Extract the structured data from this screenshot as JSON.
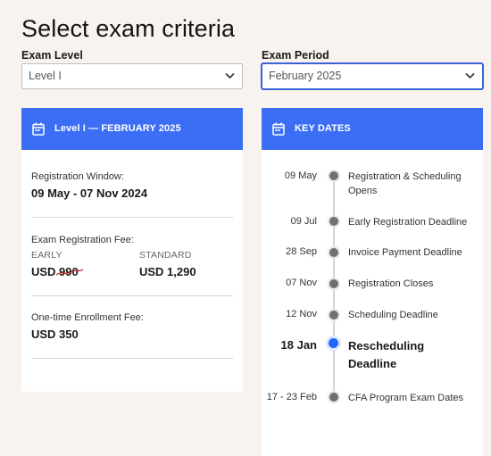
{
  "page": {
    "title": "Select exam criteria"
  },
  "filters": {
    "level_label": "Exam Level",
    "level_value": "Level I",
    "period_label": "Exam Period",
    "period_value": "February 2025"
  },
  "summary_card": {
    "title": "Level I — FEBRUARY 2025",
    "registration_window_label": "Registration Window:",
    "registration_window_value": "09 May - 07 Nov 2024",
    "fee_label": "Exam Registration Fee:",
    "early_label": "EARLY",
    "early_value": "USD 990",
    "standard_label": "STANDARD",
    "standard_value": "USD 1,290",
    "enrollment_label": "One-time Enrollment Fee:",
    "enrollment_value": "USD 350"
  },
  "key_dates": {
    "title": "KEY DATES",
    "items": [
      {
        "date": "09 May",
        "text": "Registration & Scheduling Opens"
      },
      {
        "date": "09 Jul",
        "text": "Early Registration Deadline"
      },
      {
        "date": "28 Sep",
        "text": "Invoice Payment Deadline"
      },
      {
        "date": "07 Nov",
        "text": "Registration Closes"
      },
      {
        "date": "12 Nov",
        "text": "Scheduling Deadline"
      },
      {
        "date": "18 Jan",
        "text": "Rescheduling Deadline",
        "current": true
      },
      {
        "date": "17 - 23 Feb",
        "text": "CFA Program Exam Dates"
      }
    ]
  },
  "colors": {
    "accent": "#3b6ef5",
    "active_dot": "#1f66ff",
    "background": "#f8f3ee",
    "strike": "#c4212f"
  },
  "icons": {
    "calendar": "calendar-icon",
    "chevron": "chevron-down-icon"
  }
}
